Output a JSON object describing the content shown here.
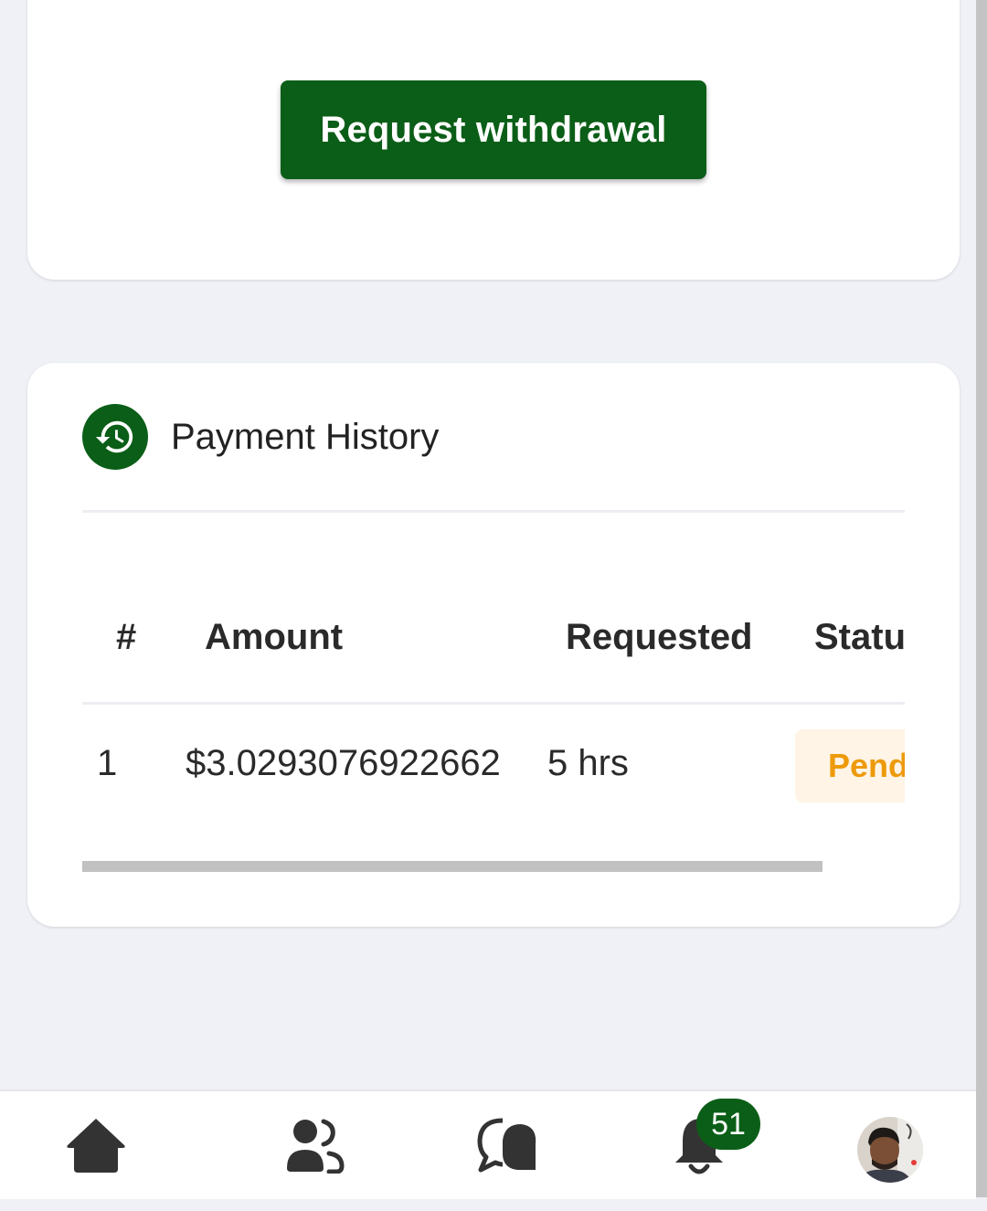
{
  "withdraw": {
    "button_label": "Request withdrawal"
  },
  "history": {
    "title": "Payment History",
    "icon": "history-icon",
    "columns": [
      "#",
      "Amount",
      "Requested",
      "Statu"
    ],
    "rows": [
      {
        "index": "1",
        "amount": "$3.0293076922662",
        "requested": "5 hrs",
        "status": "Pend"
      }
    ]
  },
  "bottom_nav": {
    "items": [
      {
        "icon": "home-icon"
      },
      {
        "icon": "users-icon"
      },
      {
        "icon": "chat-icon"
      },
      {
        "icon": "bell-icon",
        "badge": "51"
      },
      {
        "icon": "avatar"
      }
    ]
  },
  "colors": {
    "brand": "#0b5e17",
    "background": "#eff1f6",
    "status_pending_text": "#ed9a0a",
    "status_pending_bg": "#fff4e5"
  }
}
